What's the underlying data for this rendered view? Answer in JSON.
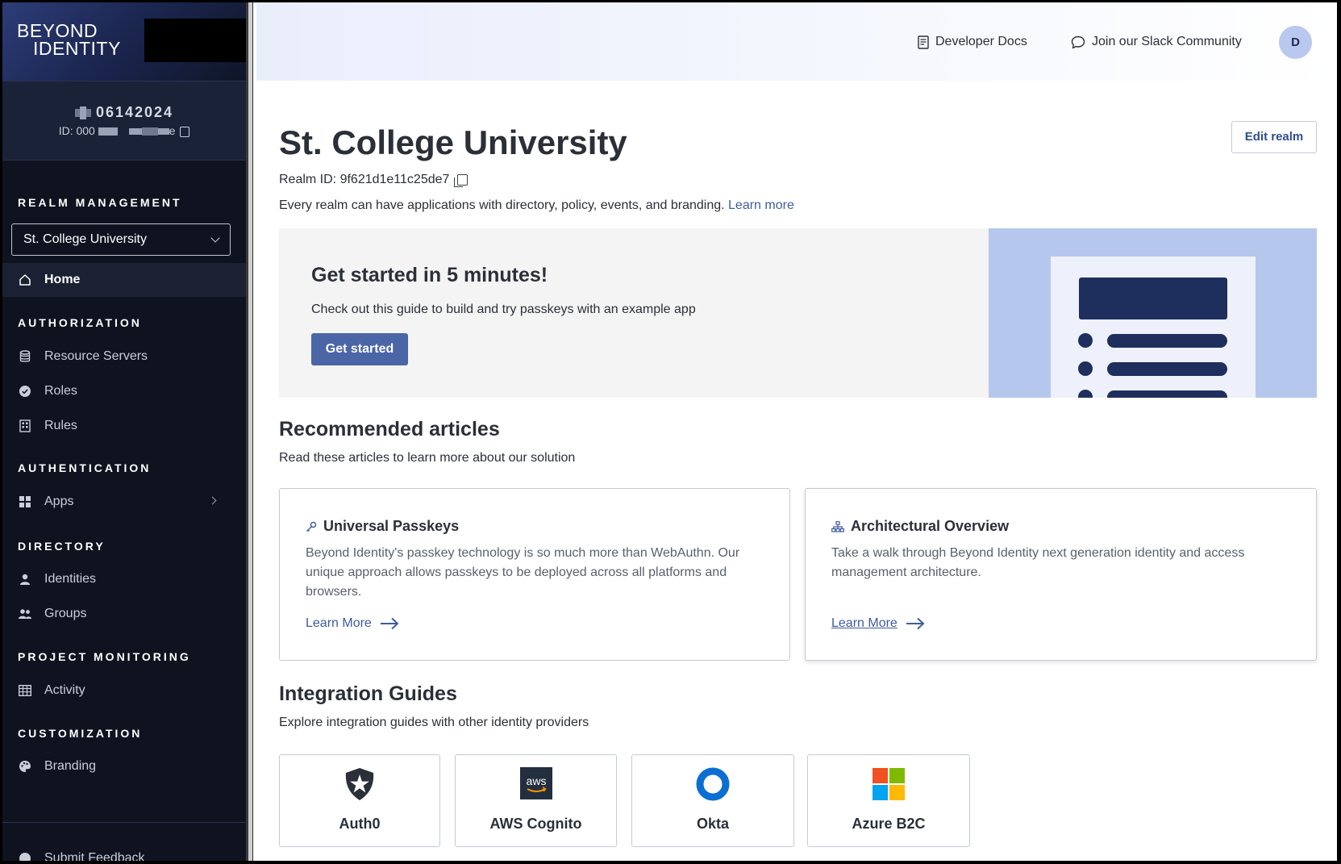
{
  "brand": {
    "logo_line1": "BEYOND",
    "logo_line2": "IDENTITY"
  },
  "tenant": {
    "name_suffix": "06142024",
    "id_prefix": "ID: 000",
    "id_suffix": "e"
  },
  "sidebar": {
    "realm_management_label": "REALM MANAGEMENT",
    "realm_selected": "St. College University",
    "home": "Home",
    "sections": {
      "authorization": "AUTHORIZATION",
      "authentication": "AUTHENTICATION",
      "directory": "DIRECTORY",
      "project_monitoring": "PROJECT MONITORING",
      "customization": "CUSTOMIZATION"
    },
    "items": {
      "resource_servers": "Resource Servers",
      "roles": "Roles",
      "rules": "Rules",
      "apps": "Apps",
      "identities": "Identities",
      "groups": "Groups",
      "activity": "Activity",
      "branding": "Branding",
      "submit_feedback": "Submit Feedback"
    }
  },
  "topbar": {
    "developer_docs": "Developer Docs",
    "slack": "Join our Slack Community",
    "avatar_initial": "D"
  },
  "main": {
    "title": "St. College University",
    "realm_id_label": "Realm ID: 9f621d1e11c25de7",
    "description": "Every realm can have applications with directory, policy, events, and branding.",
    "learn_more": "Learn more",
    "edit_realm": "Edit realm",
    "hero": {
      "title": "Get started in 5 minutes!",
      "text": "Check out this guide to build and try passkeys with an example app",
      "button": "Get started"
    },
    "recommended": {
      "title": "Recommended articles",
      "subtitle": "Read these articles to learn more about our solution",
      "cards": [
        {
          "title": "Universal Passkeys",
          "body": "Beyond Identity's passkey technology is so much more than WebAuthn. Our unique approach allows passkeys to be deployed across all platforms and browsers.",
          "link": "Learn More"
        },
        {
          "title": "Architectural Overview",
          "body": "Take a walk through Beyond Identity next generation identity and access management architecture.",
          "link": "Learn More"
        }
      ]
    },
    "integrations": {
      "title": "Integration Guides",
      "subtitle": "Explore integration guides with other identity providers",
      "items": [
        "Auth0",
        "AWS Cognito",
        "Okta",
        "Azure B2C"
      ],
      "aws_logo_text": "aws"
    }
  },
  "colors": {
    "sidebar_bg": "#0f1320",
    "accent": "#4a66a6",
    "link": "#3e5c9e",
    "hero_art": "#b6c7ee",
    "hero_art_dark": "#1e2f5e"
  }
}
